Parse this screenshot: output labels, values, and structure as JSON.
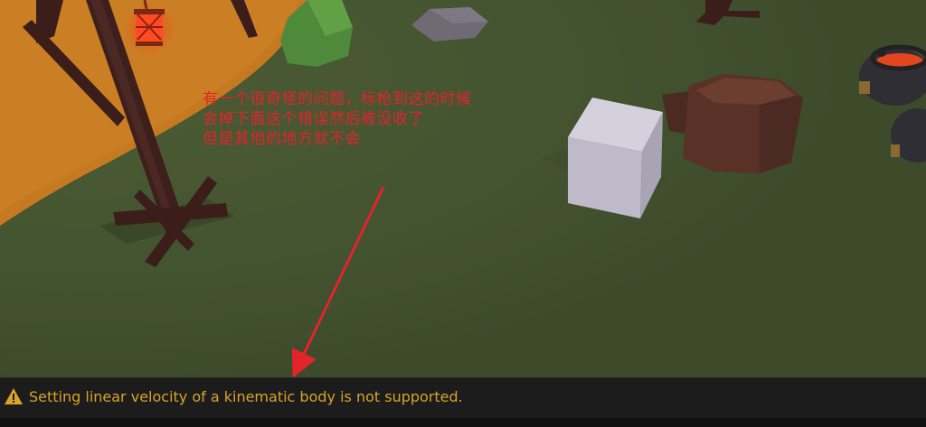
{
  "annotation": {
    "lines": [
      "有一个很奇怪的问题，标枪到这的时候",
      "会掉下面这个错误然后被没收了",
      "但是其他的地方就不会"
    ]
  },
  "console": {
    "level": "warning",
    "icon": "warning-icon",
    "message": "Setting linear velocity of a kinematic body is not supported.",
    "warning_color": "#d9a32c",
    "arrow_color": "#e4232b"
  }
}
